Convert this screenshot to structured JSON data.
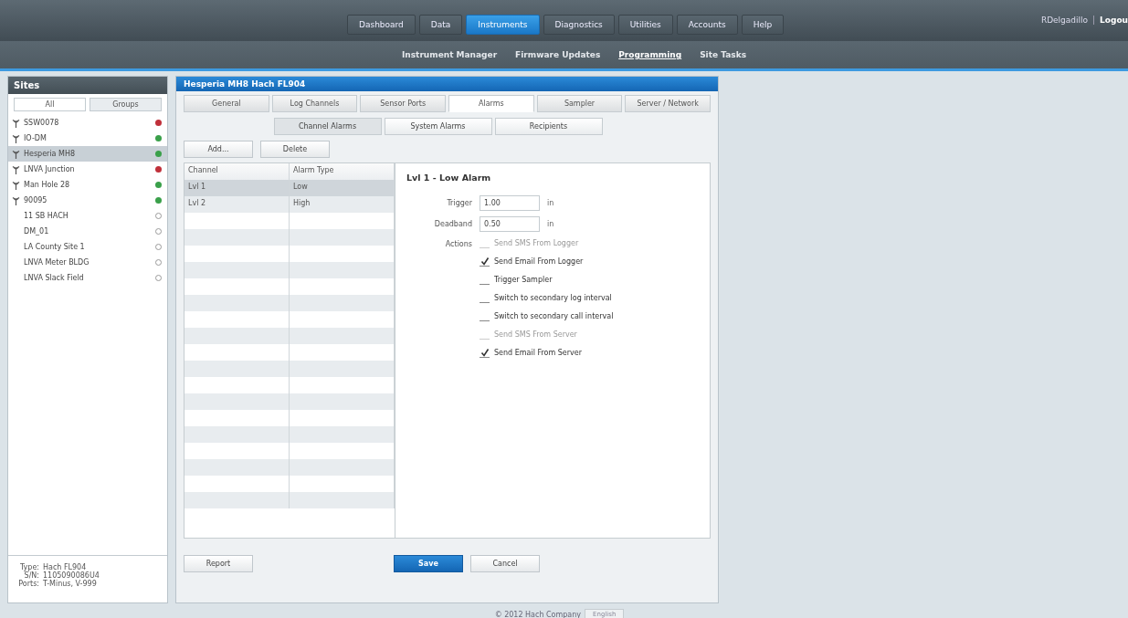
{
  "nav": {
    "items": [
      {
        "label": "Dashboard",
        "selected": false
      },
      {
        "label": "Data",
        "selected": false
      },
      {
        "label": "Instruments",
        "selected": true
      },
      {
        "label": "Diagnostics",
        "selected": false
      },
      {
        "label": "Utilities",
        "selected": false
      },
      {
        "label": "Accounts",
        "selected": false
      },
      {
        "label": "Help",
        "selected": false
      }
    ],
    "subitems": [
      {
        "label": "Instrument Manager",
        "selected": false
      },
      {
        "label": "Firmware Updates",
        "selected": false
      },
      {
        "label": "Programming",
        "selected": true
      },
      {
        "label": "Site Tasks",
        "selected": false
      }
    ],
    "user": "RDelgadillo",
    "logout": "Logou"
  },
  "sites": {
    "title": "Sites",
    "tabs": [
      {
        "label": "All",
        "selected": true
      },
      {
        "label": "Groups",
        "selected": false
      }
    ],
    "items": [
      {
        "name": "SSW0078",
        "kind": "logger",
        "color": "#c0303a",
        "selected": false
      },
      {
        "name": "IO-DM",
        "kind": "logger",
        "color": "#3aa04a",
        "selected": false
      },
      {
        "name": "Hesperia MH8",
        "kind": "logger",
        "color": "#3aa04a",
        "selected": true
      },
      {
        "name": "LNVA Junction",
        "kind": "logger",
        "color": "#c0303a",
        "selected": false
      },
      {
        "name": "Man Hole 28",
        "kind": "logger",
        "color": "#3aa04a",
        "selected": false
      },
      {
        "name": "90095",
        "kind": "logger",
        "color": "#3aa04a",
        "selected": false
      },
      {
        "name": "11 SB HACH",
        "kind": "site",
        "selected": false
      },
      {
        "name": "DM_01",
        "kind": "site",
        "selected": false
      },
      {
        "name": "LA County Site 1",
        "kind": "site",
        "selected": false
      },
      {
        "name": "LNVA Meter BLDG",
        "kind": "site",
        "selected": false
      },
      {
        "name": "LNVA Slack Field",
        "kind": "site",
        "selected": false
      }
    ],
    "info": [
      {
        "label": "Type:",
        "value": "Hach FL904"
      },
      {
        "label": "S/N:",
        "value": "1105090086U4"
      },
      {
        "label": "Ports:",
        "value": "T-Minus, V-999"
      }
    ]
  },
  "panel": {
    "title": "Hesperia MH8   Hach FL904",
    "tabs": [
      {
        "label": "General",
        "selected": false
      },
      {
        "label": "Log Channels",
        "selected": false
      },
      {
        "label": "Sensor Ports",
        "selected": false
      },
      {
        "label": "Alarms",
        "selected": true
      },
      {
        "label": "Sampler",
        "selected": false
      },
      {
        "label": "Server / Network",
        "selected": false
      }
    ],
    "subtabs": [
      {
        "label": "Channel Alarms",
        "selected": true
      },
      {
        "label": "System Alarms",
        "selected": false
      },
      {
        "label": "Recipients",
        "selected": false
      }
    ],
    "buttons": [
      "Add...",
      "Delete"
    ],
    "table": {
      "columns": [
        "Channel",
        "Alarm Type"
      ],
      "rows": [
        {
          "cells": [
            "Lvl 1",
            "Low"
          ],
          "selected": true
        },
        {
          "cells": [
            "Lvl 2",
            "High"
          ],
          "selected": false
        }
      ]
    },
    "detail": {
      "title": "Lvl 1  -  Low Alarm",
      "fields": [
        {
          "label": "Trigger",
          "value": "1.00",
          "unit": "in"
        },
        {
          "label": "Deadband",
          "value": "0.50",
          "unit": "in"
        }
      ],
      "actions_label": "Actions",
      "actions": [
        {
          "label": "Send SMS From Logger",
          "checked": false,
          "disabled": true
        },
        {
          "label": "Send Email From Logger",
          "checked": true,
          "disabled": false
        },
        {
          "label": "Trigger Sampler",
          "checked": false,
          "disabled": false
        },
        {
          "label": "Switch to secondary log interval",
          "checked": false,
          "disabled": false
        },
        {
          "label": "Switch to secondary call interval",
          "checked": false,
          "disabled": false
        },
        {
          "label": "Send SMS From Server",
          "checked": false,
          "disabled": true
        },
        {
          "label": "Send Email From Server",
          "checked": true,
          "disabled": false
        }
      ]
    },
    "footer_buttons": [
      {
        "label": "Report",
        "kind": "normal"
      },
      {
        "label": "Save",
        "kind": "primary"
      },
      {
        "label": "Cancel",
        "kind": "normal"
      }
    ]
  },
  "footer": {
    "copyright": "© 2012 Hach Company",
    "language": "English"
  }
}
